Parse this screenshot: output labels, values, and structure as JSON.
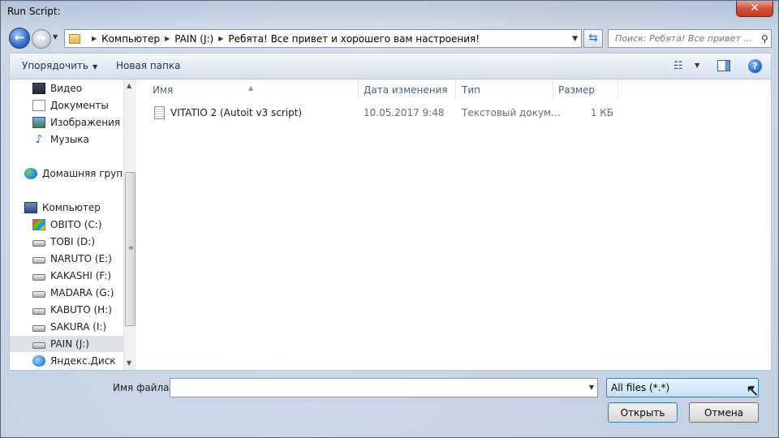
{
  "window": {
    "title": "Run Script:",
    "close_label": "✕"
  },
  "nav": {
    "back_icon": "arrow-left-icon",
    "forward_icon": "arrow-right-icon",
    "breadcrumb": [
      "Компьютер",
      "PAIN (J:)",
      "Ребята! Все привет и хорошего вам настроения!"
    ],
    "search_placeholder": "Поиск: Ребята! Все привет ..."
  },
  "toolbar": {
    "organize": "Упорядочить",
    "new_folder": "Новая папка"
  },
  "sidebar": {
    "items": [
      {
        "label": "Видео",
        "icon": "video-icon"
      },
      {
        "label": "Документы",
        "icon": "documents-icon"
      },
      {
        "label": "Изображения",
        "icon": "images-icon"
      },
      {
        "label": "Музыка",
        "icon": "music-icon"
      },
      {
        "label": "Домашняя группа",
        "icon": "homegroup-icon"
      },
      {
        "label": "Компьютер",
        "icon": "computer-icon"
      },
      {
        "label": "OBITO (C:)",
        "icon": "system-drive-icon"
      },
      {
        "label": "TOBI (D:)",
        "icon": "drive-icon"
      },
      {
        "label": "NARUTO (E:)",
        "icon": "drive-icon"
      },
      {
        "label": "KAKASHI (F:)",
        "icon": "drive-icon"
      },
      {
        "label": "MADARA (G:)",
        "icon": "drive-icon"
      },
      {
        "label": "KABUTO (H:)",
        "icon": "drive-icon"
      },
      {
        "label": "SAKURA (I:)",
        "icon": "drive-icon"
      },
      {
        "label": "PAIN (J:)",
        "icon": "drive-icon",
        "selected": true
      },
      {
        "label": "Яндекс.Диск",
        "icon": "yandex-disk-icon"
      }
    ]
  },
  "files": {
    "columns": [
      "Имя",
      "Дата изменения",
      "Тип",
      "Размер"
    ],
    "rows": [
      {
        "name": "VITATIO 2 (Autoit v3 script)",
        "date": "10.05.2017 9:48",
        "type": "Текстовый докум...",
        "size": "1 КБ"
      }
    ]
  },
  "bottom": {
    "filename_label": "Имя файла:",
    "filename_value": "",
    "filetype_value": "All files (*.*)",
    "open_label": "Открыть",
    "cancel_label": "Отмена"
  }
}
